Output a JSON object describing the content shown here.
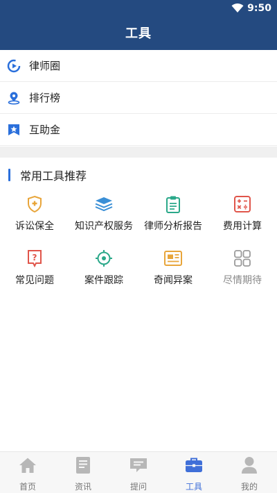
{
  "status_bar": {
    "time": "9:50",
    "wifi_icon": "wifi-icon"
  },
  "header": {
    "title": "工具"
  },
  "menu_items": [
    {
      "label": "律师圈",
      "icon": "play-circle-icon"
    },
    {
      "label": "排行榜",
      "icon": "location-pin-icon"
    },
    {
      "label": "互助金",
      "icon": "star-bookmark-icon"
    }
  ],
  "section": {
    "title": "常用工具推荐"
  },
  "tools": [
    {
      "label": "诉讼保全",
      "icon": "shield-plus-icon"
    },
    {
      "label": "知识产权服务",
      "icon": "layers-icon"
    },
    {
      "label": "律师分析报告",
      "icon": "clipboard-icon"
    },
    {
      "label": "费用计算",
      "icon": "calculator-icon"
    },
    {
      "label": "常见问题",
      "icon": "question-doc-icon"
    },
    {
      "label": "案件跟踪",
      "icon": "target-icon"
    },
    {
      "label": "奇闻异案",
      "icon": "newspaper-icon"
    },
    {
      "label": "尽情期待",
      "icon": "grid-icon"
    }
  ],
  "tabbar": {
    "active_index": 3,
    "tabs": [
      {
        "label": "首页",
        "icon": "home-icon"
      },
      {
        "label": "资讯",
        "icon": "document-icon"
      },
      {
        "label": "提问",
        "icon": "chat-icon"
      },
      {
        "label": "工具",
        "icon": "toolbox-icon"
      },
      {
        "label": "我的",
        "icon": "person-icon"
      }
    ]
  },
  "colors": {
    "header_bg": "#244a80",
    "accent": "#3f6fd8",
    "inactive": "#b7b7b7"
  }
}
